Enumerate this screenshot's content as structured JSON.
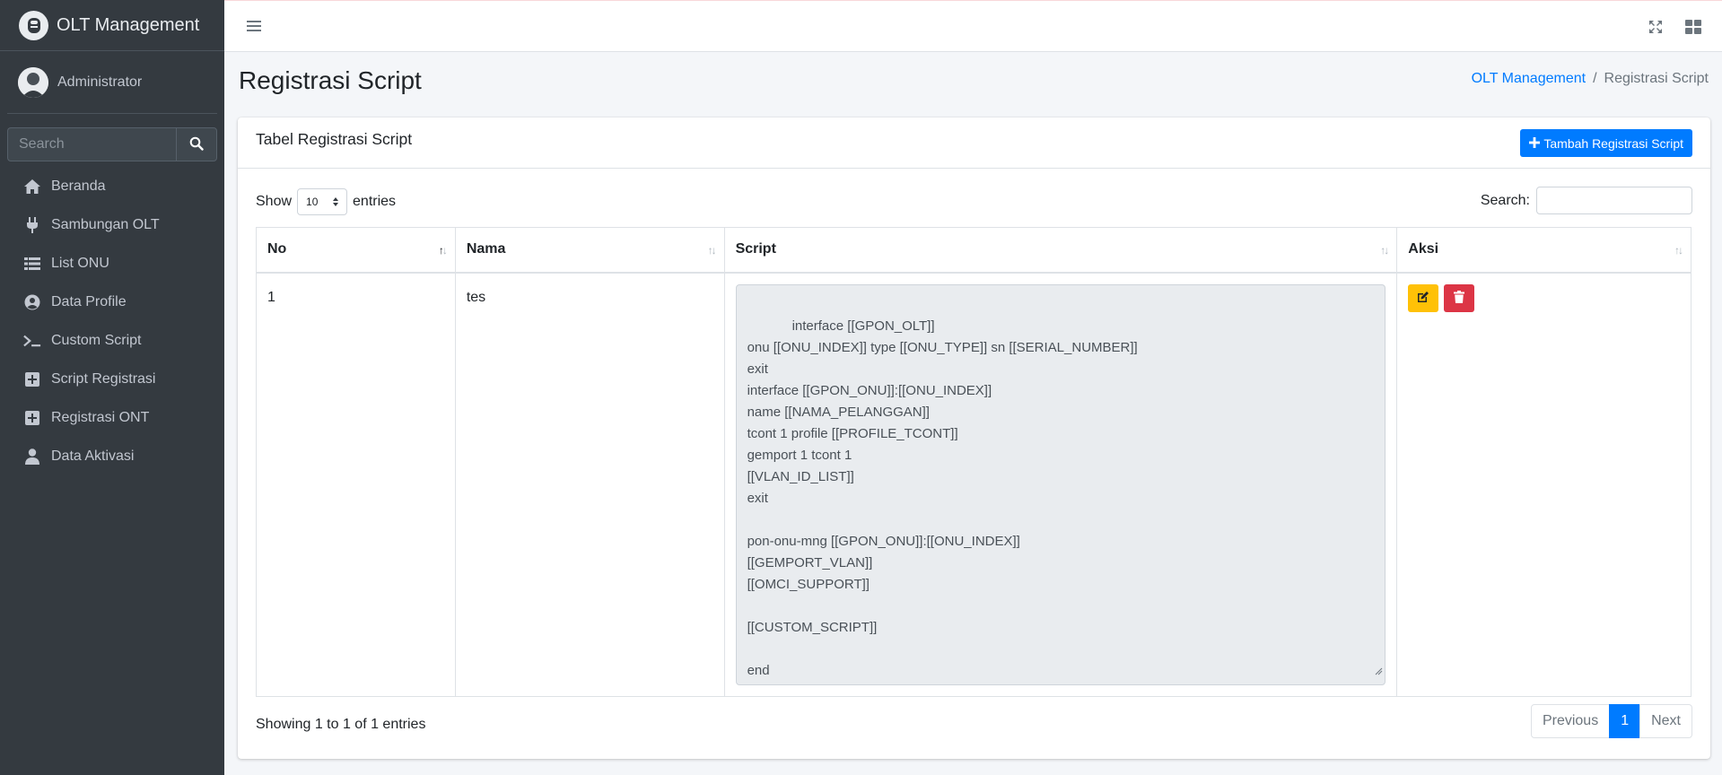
{
  "app": {
    "brand": "OLT Management",
    "user": "Administrator"
  },
  "sidebar": {
    "search_placeholder": "Search",
    "items": [
      {
        "label": "Beranda",
        "icon": "home-icon"
      },
      {
        "label": "Sambungan OLT",
        "icon": "plug-icon"
      },
      {
        "label": "List ONU",
        "icon": "list-icon"
      },
      {
        "label": "Data Profile",
        "icon": "user-circle-icon"
      },
      {
        "label": "Custom Script",
        "icon": "terminal-icon"
      },
      {
        "label": "Script Registrasi",
        "icon": "plus-square-icon"
      },
      {
        "label": "Registrasi ONT",
        "icon": "plus-square-icon"
      },
      {
        "label": "Data Aktivasi",
        "icon": "user-icon"
      }
    ]
  },
  "header": {
    "title": "Registrasi Script",
    "breadcrumb": {
      "home": "OLT Management",
      "current": "Registrasi Script"
    }
  },
  "card": {
    "title": "Tabel Registrasi Script",
    "add_button": "Tambah Registrasi Script",
    "show_label": "Show",
    "entries_value": "10",
    "entries_label": "entries",
    "search_label": "Search:"
  },
  "table": {
    "columns": [
      "No",
      "Nama",
      "Script",
      "Aksi"
    ],
    "rows": [
      {
        "no": "1",
        "nama": "tes",
        "script": "interface [[GPON_OLT]]\nonu [[ONU_INDEX]] type [[ONU_TYPE]] sn [[SERIAL_NUMBER]]\nexit\ninterface [[GPON_ONU]]:[[ONU_INDEX]]\nname [[NAMA_PELANGGAN]]\ntcont 1 profile [[PROFILE_TCONT]]\ngemport 1 tcont 1\n[[VLAN_ID_LIST]]\nexit\n\npon-onu-mng [[GPON_ONU]]:[[ONU_INDEX]]\n[[GEMPORT_VLAN]]\n[[OMCI_SUPPORT]]\n\n[[CUSTOM_SCRIPT]]\n\nend\nwrite"
      }
    ]
  },
  "footer": {
    "info": "Showing 1 to 1 of 1 entries",
    "previous": "Previous",
    "page": "1",
    "next": "Next"
  },
  "colors": {
    "sidebar": "#343a40",
    "primary": "#007bff",
    "warning": "#ffc107",
    "danger": "#dc3545"
  }
}
